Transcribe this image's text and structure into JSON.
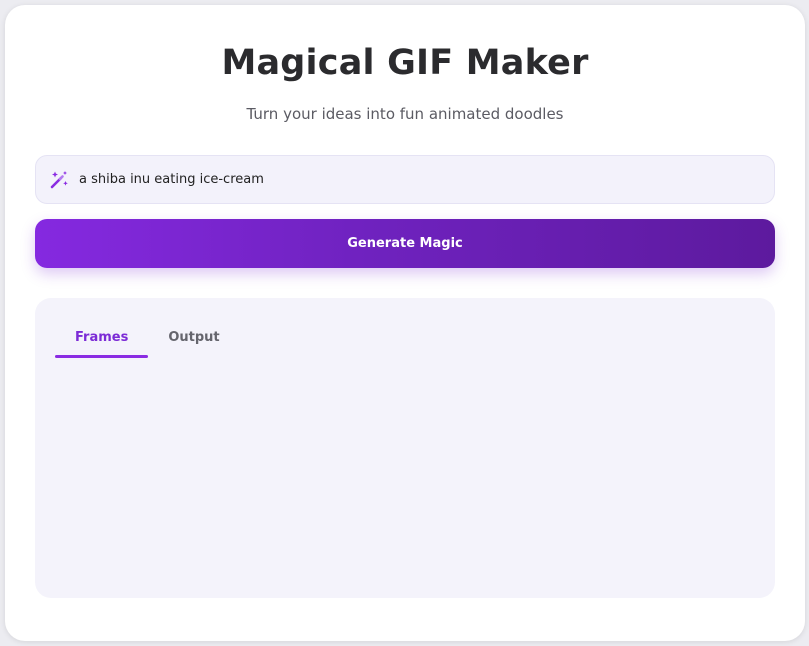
{
  "app": {
    "title": "Magical GIF Maker",
    "subtitle": "Turn your ideas into fun animated doodles"
  },
  "prompt": {
    "value": "a shiba inu eating ice-cream",
    "icon": "magic-wand-icon"
  },
  "generate": {
    "label": "Generate Magic"
  },
  "tabs": [
    {
      "label": "Frames",
      "active": true
    },
    {
      "label": "Output",
      "active": false
    }
  ],
  "colors": {
    "accent": "#8a2be2",
    "accent_dark": "#5d1a9e",
    "panel_bg": "#f4f3fb"
  }
}
